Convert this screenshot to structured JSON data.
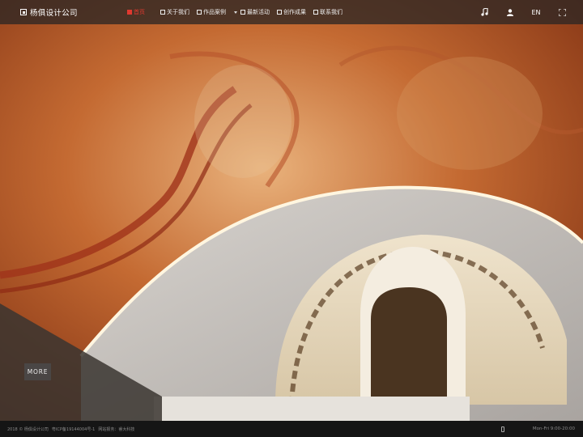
{
  "brand": {
    "name": "杨俱设计公司",
    "logo_icon": "logo-square-icon"
  },
  "nav": {
    "items": [
      {
        "label": "首页",
        "icon": "home-icon",
        "active": true
      },
      {
        "label": "关于我们",
        "icon": "about-icon",
        "active": false
      },
      {
        "label": "作品案例",
        "icon": "works-icon",
        "active": false,
        "has_dropdown": true
      },
      {
        "label": "最新活动",
        "icon": "news-icon",
        "active": false
      },
      {
        "label": "创作成果",
        "icon": "achievements-icon",
        "active": false
      },
      {
        "label": "联系我们",
        "icon": "contact-icon",
        "active": false
      }
    ],
    "active_color": "#e0392f"
  },
  "tools": {
    "music_icon": "music-note-icon",
    "user_icon": "user-icon",
    "lang_label": "EN",
    "fullscreen_icon": "fullscreen-icon"
  },
  "hero": {
    "more_label": "MORE"
  },
  "footer": {
    "copyright": "2018 © 杨俱设计公司",
    "icp": "粤ICP备19144004号-1",
    "support": "网站报务：睿大科技",
    "hours": "Mon-Fri 9:00-20:00",
    "phone_icon": "phone-icon"
  }
}
